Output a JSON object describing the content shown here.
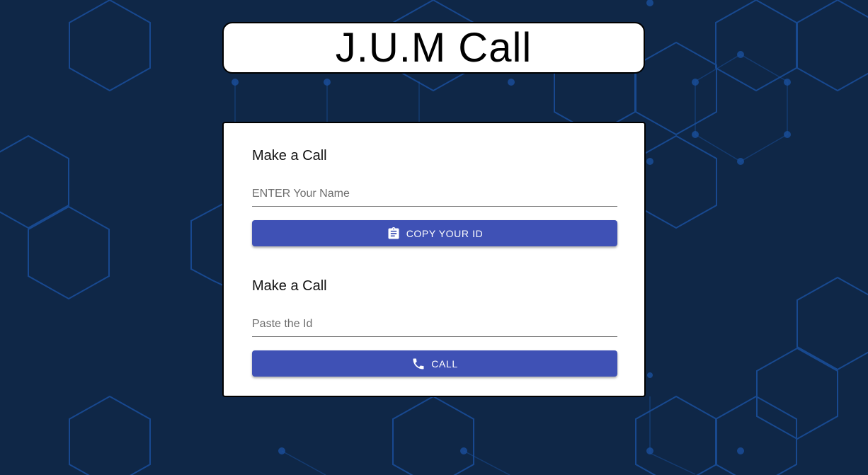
{
  "header": {
    "title": "J.U.M Call"
  },
  "card": {
    "section1": {
      "heading": "Make a Call",
      "name_input": {
        "placeholder": "ENTER Your Name",
        "value": ""
      },
      "copy_button": {
        "label": "Copy Your ID",
        "icon": "clipboard-icon"
      }
    },
    "section2": {
      "heading": "Make a Call",
      "id_input": {
        "placeholder": "Paste the Id",
        "value": ""
      },
      "call_button": {
        "label": "Call",
        "icon": "phone-icon"
      }
    }
  },
  "colors": {
    "background": "#0f2747",
    "hex_pattern": "#1a4f9c",
    "button": "#3f51b5"
  }
}
